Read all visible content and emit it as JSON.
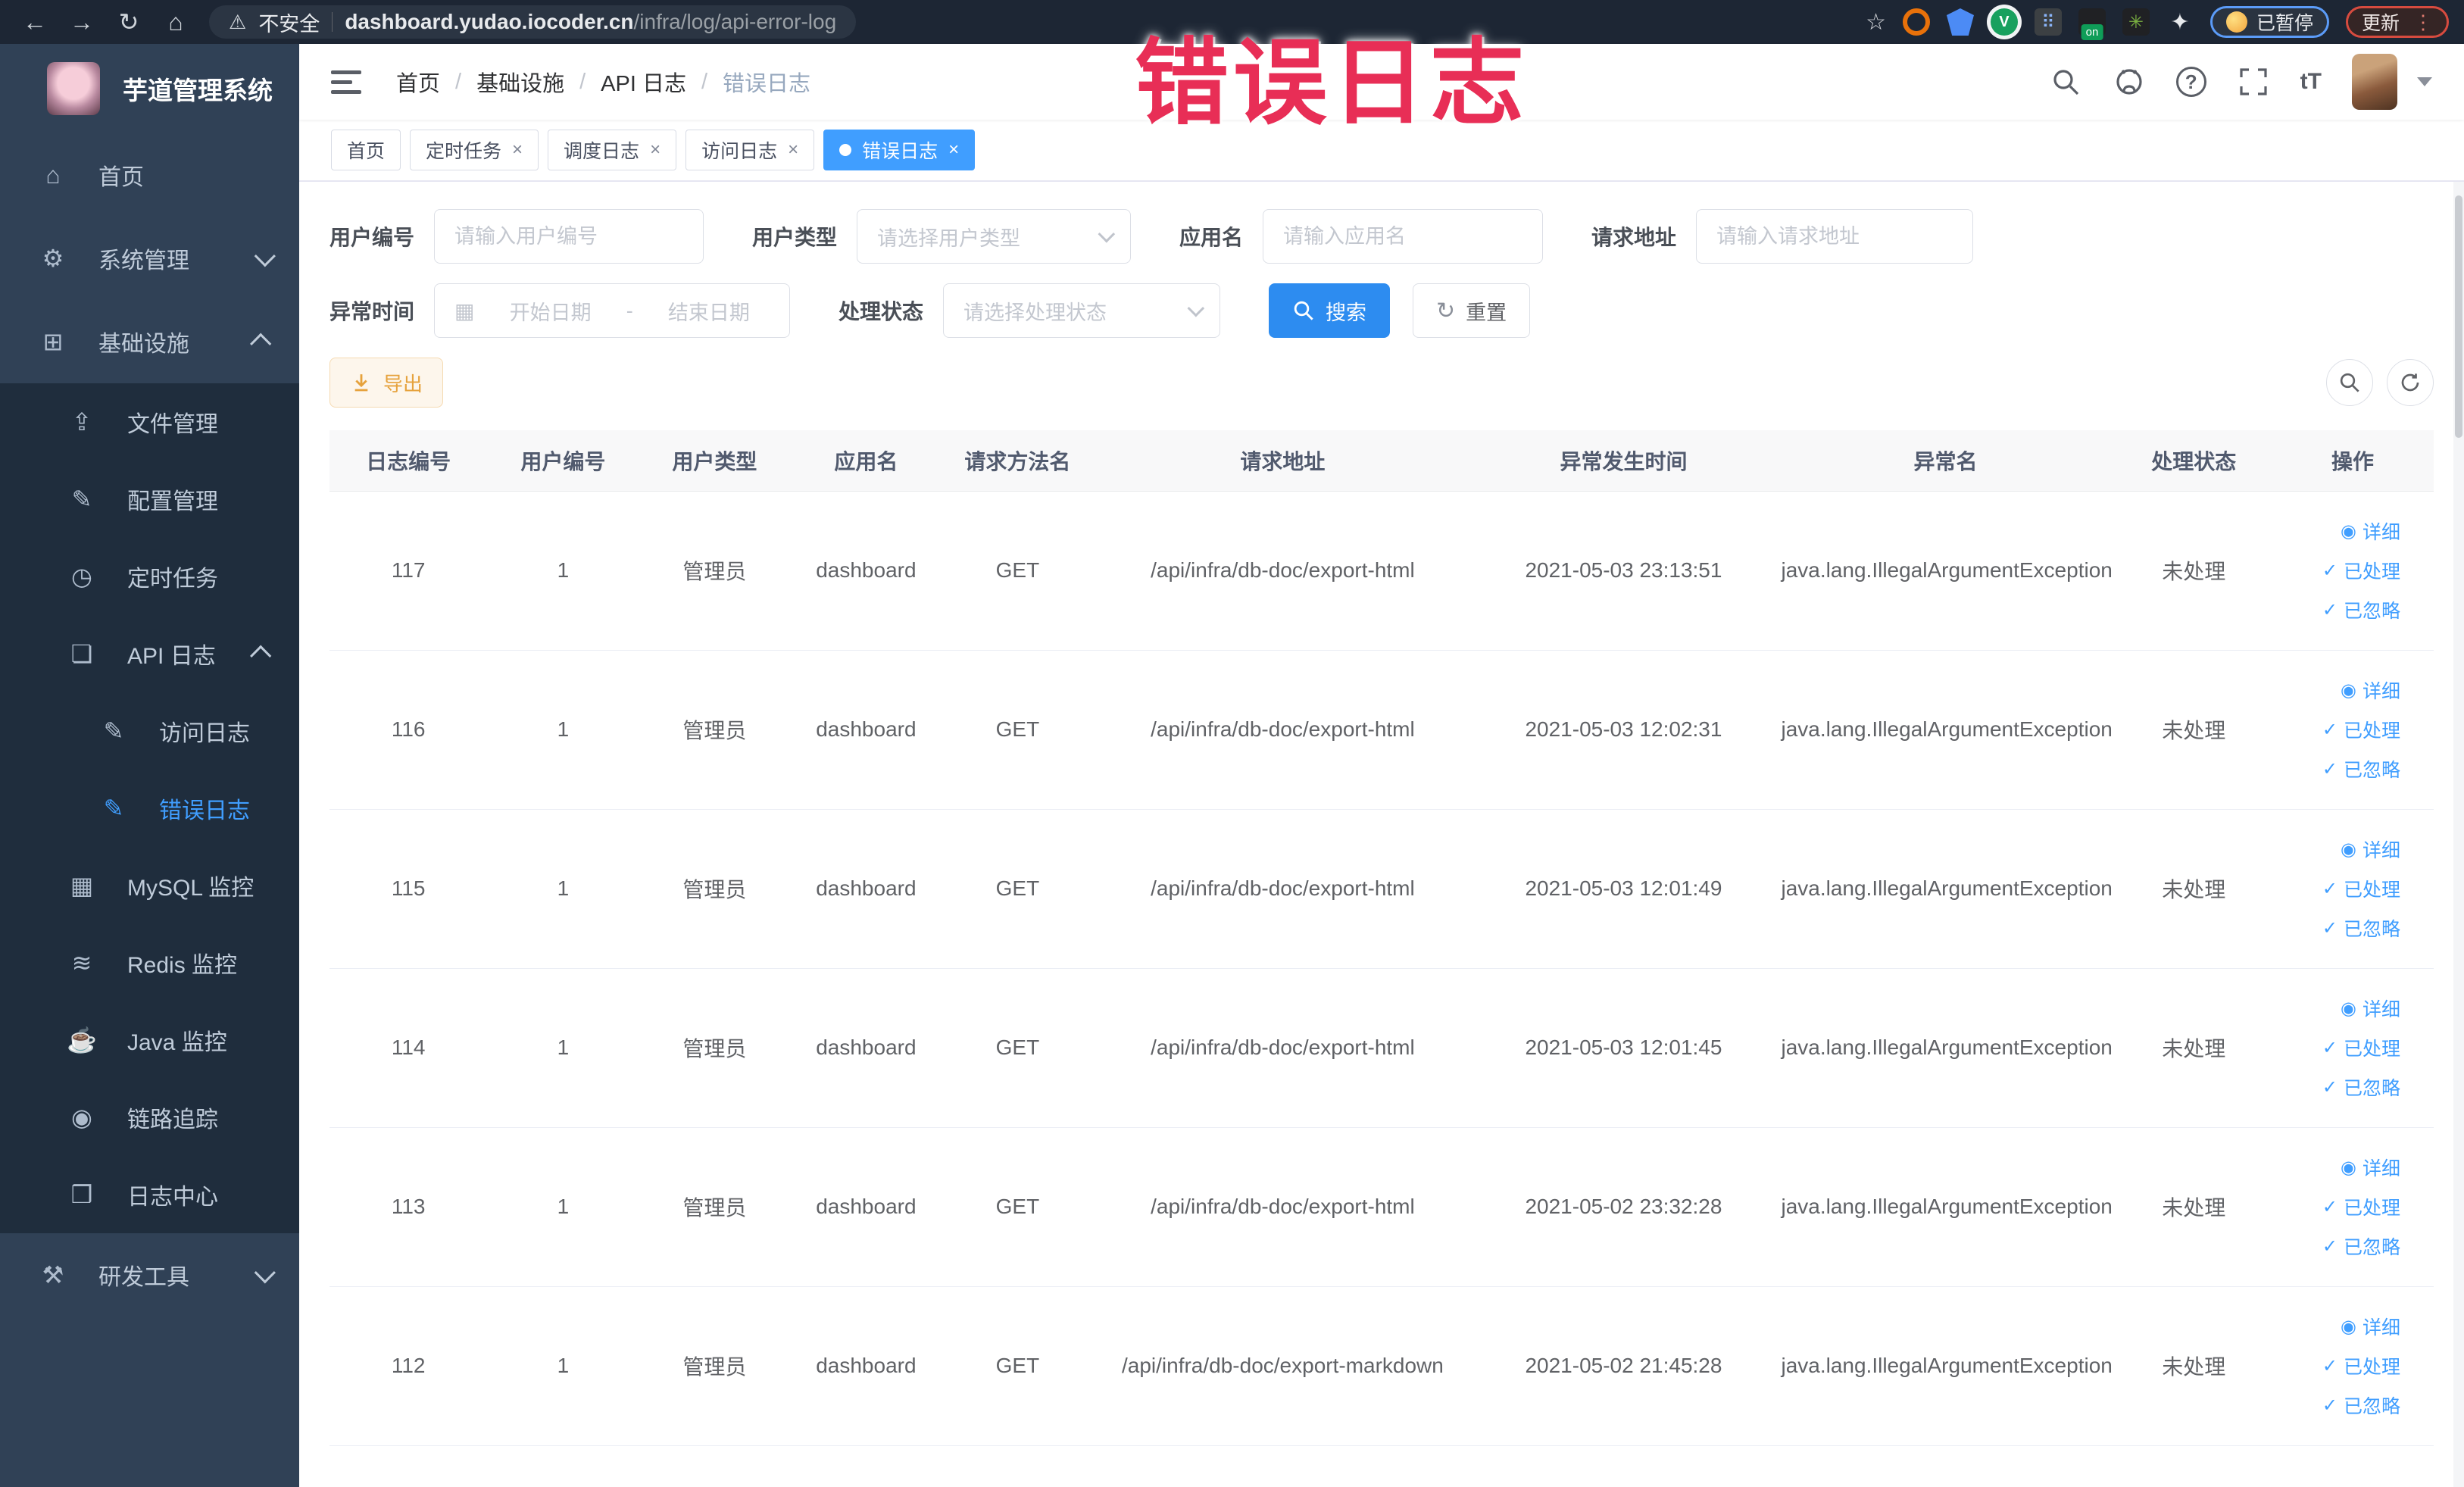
{
  "colors": {
    "accent": "#409eff",
    "sidebar_bg": "#304156",
    "submenu_bg": "#1f2d3d",
    "active_tab_bg": "#409eff",
    "warning_btn_text": "#e6a23c",
    "annotation_red": "#e82e56"
  },
  "browser": {
    "nav": {
      "back": "←",
      "forward": "→",
      "reload": "↻",
      "home": "⌂"
    },
    "warning_glyph": "⚠",
    "security_label": "不安全",
    "url_host": "dashboard.yudao.iocoder.cn",
    "url_path": "/infra/log/api-error-log",
    "star_glyph": "☆",
    "grid_glyph": "⠿",
    "green_v_glyph": "V",
    "on_badge": "on",
    "leaf_glyph": "✳",
    "puzzle_glyph": "✦",
    "paused_label": "已暂停",
    "update_label": "更新",
    "kebab_glyph": "⋮"
  },
  "annotation": {
    "text": "错误日志"
  },
  "sidebar": {
    "app_title": "芋道管理系统",
    "items": [
      {
        "key": "home",
        "label": "首页",
        "icon": "home-icon",
        "glyph": "⌂",
        "level": 1
      },
      {
        "key": "system-management",
        "label": "系统管理",
        "icon": "gear-icon",
        "glyph": "⚙",
        "level": 1,
        "chevron": "down"
      },
      {
        "key": "infrastructure",
        "label": "基础设施",
        "icon": "monitor-icon",
        "glyph": "⊞",
        "level": 1,
        "chevron": "up"
      },
      {
        "key": "file-management",
        "label": "文件管理",
        "icon": "upload-icon",
        "glyph": "⇪",
        "level": 2
      },
      {
        "key": "config-management",
        "label": "配置管理",
        "icon": "edit-icon",
        "glyph": "✎",
        "level": 2
      },
      {
        "key": "scheduled-jobs",
        "label": "定时任务",
        "icon": "clock-icon",
        "glyph": "◷",
        "level": 2
      },
      {
        "key": "api-log",
        "label": "API 日志",
        "icon": "document-edit-icon",
        "glyph": "❏",
        "level": 2,
        "chevron": "up"
      },
      {
        "key": "access-log",
        "label": "访问日志",
        "icon": "document-edit-icon",
        "glyph": "✎",
        "level": 3
      },
      {
        "key": "error-log",
        "label": "错误日志",
        "icon": "document-edit-icon",
        "glyph": "✎",
        "level": 3,
        "active": true
      },
      {
        "key": "mysql-monitor",
        "label": "MySQL 监控",
        "icon": "database-icon",
        "glyph": "▦",
        "level": 2
      },
      {
        "key": "redis-monitor",
        "label": "Redis 监控",
        "icon": "layers-icon",
        "glyph": "≋",
        "level": 2
      },
      {
        "key": "java-monitor",
        "label": "Java 监控",
        "icon": "coffee-icon",
        "glyph": "☕",
        "level": 2
      },
      {
        "key": "trace",
        "label": "链路追踪",
        "icon": "eye-icon",
        "glyph": "◉",
        "level": 2
      },
      {
        "key": "log-center",
        "label": "日志中心",
        "icon": "document-icon",
        "glyph": "❒",
        "level": 2
      },
      {
        "key": "dev-tools",
        "label": "研发工具",
        "icon": "toolbox-icon",
        "glyph": "⚒",
        "level": 1,
        "chevron": "down"
      }
    ]
  },
  "header": {
    "breadcrumb": [
      "首页",
      "基础设施",
      "API 日志",
      "错误日志"
    ],
    "separator": "/",
    "help_glyph": "?",
    "font_glyph": "tT"
  },
  "tabs": [
    {
      "label": "首页",
      "closable": false,
      "active": false
    },
    {
      "label": "定时任务",
      "closable": true,
      "active": false
    },
    {
      "label": "调度日志",
      "closable": true,
      "active": false
    },
    {
      "label": "访问日志",
      "closable": true,
      "active": false
    },
    {
      "label": "错误日志",
      "closable": true,
      "active": true
    }
  ],
  "close_glyph": "×",
  "filters": {
    "user_id": {
      "label": "用户编号",
      "placeholder": "请输入用户编号"
    },
    "user_type": {
      "label": "用户类型",
      "placeholder": "请选择用户类型"
    },
    "app_name": {
      "label": "应用名",
      "placeholder": "请输入应用名"
    },
    "request_url": {
      "label": "请求地址",
      "placeholder": "请输入请求地址"
    },
    "exception_time": {
      "label": "异常时间",
      "calendar_glyph": "▦",
      "start_placeholder": "开始日期",
      "separator": "-",
      "end_placeholder": "结束日期"
    },
    "process_status": {
      "label": "处理状态",
      "placeholder": "请选择处理状态"
    },
    "search_button": "搜索",
    "reset_button": "重置",
    "reset_glyph": "↻"
  },
  "toolbar": {
    "export_button": "导出"
  },
  "table": {
    "headers": [
      "日志编号",
      "用户编号",
      "用户类型",
      "应用名",
      "请求方法名",
      "请求地址",
      "异常发生时间",
      "异常名",
      "处理状态",
      "操作"
    ],
    "actions": [
      {
        "label": "详细",
        "icon": "eye-icon",
        "glyph": "◉"
      },
      {
        "label": "已处理",
        "icon": "check-icon",
        "glyph": "✓"
      },
      {
        "label": "已忽略",
        "icon": "check-icon",
        "glyph": "✓"
      }
    ],
    "rows": [
      {
        "id": "117",
        "user_id": "1",
        "user_type": "管理员",
        "app": "dashboard",
        "method": "GET",
        "url": "/api/infra/db-doc/export-html",
        "time": "2021-05-03 23:13:51",
        "exception": "java.lang.IllegalArgumentException",
        "status": "未处理"
      },
      {
        "id": "116",
        "user_id": "1",
        "user_type": "管理员",
        "app": "dashboard",
        "method": "GET",
        "url": "/api/infra/db-doc/export-html",
        "time": "2021-05-03 12:02:31",
        "exception": "java.lang.IllegalArgumentException",
        "status": "未处理"
      },
      {
        "id": "115",
        "user_id": "1",
        "user_type": "管理员",
        "app": "dashboard",
        "method": "GET",
        "url": "/api/infra/db-doc/export-html",
        "time": "2021-05-03 12:01:49",
        "exception": "java.lang.IllegalArgumentException",
        "status": "未处理"
      },
      {
        "id": "114",
        "user_id": "1",
        "user_type": "管理员",
        "app": "dashboard",
        "method": "GET",
        "url": "/api/infra/db-doc/export-html",
        "time": "2021-05-03 12:01:45",
        "exception": "java.lang.IllegalArgumentException",
        "status": "未处理"
      },
      {
        "id": "113",
        "user_id": "1",
        "user_type": "管理员",
        "app": "dashboard",
        "method": "GET",
        "url": "/api/infra/db-doc/export-html",
        "time": "2021-05-02 23:32:28",
        "exception": "java.lang.IllegalArgumentException",
        "status": "未处理"
      },
      {
        "id": "112",
        "user_id": "1",
        "user_type": "管理员",
        "app": "dashboard",
        "method": "GET",
        "url": "/api/infra/db-doc/export-markdown",
        "time": "2021-05-02 21:45:28",
        "exception": "java.lang.IllegalArgumentException",
        "status": "未处理"
      }
    ]
  }
}
